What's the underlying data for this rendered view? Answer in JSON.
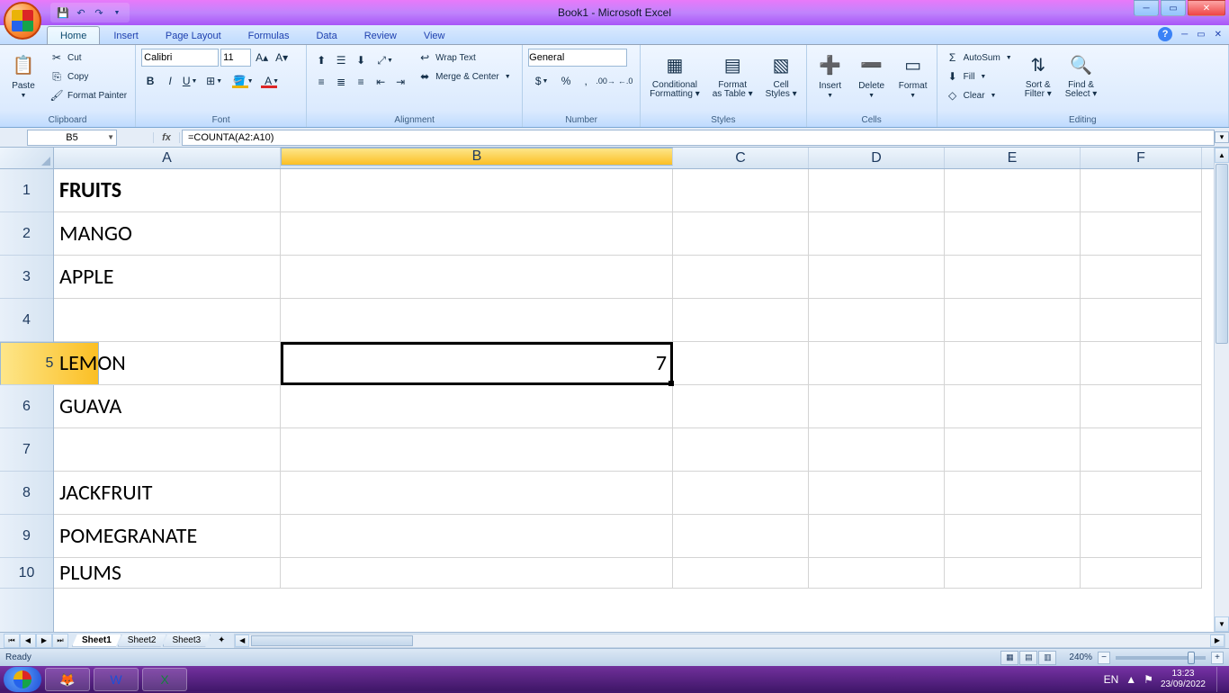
{
  "title": "Book1 - Microsoft Excel",
  "tabs": {
    "home": "Home",
    "insert": "Insert",
    "pagelayout": "Page Layout",
    "formulas": "Formulas",
    "data": "Data",
    "review": "Review",
    "view": "View"
  },
  "clipboard": {
    "label": "Clipboard",
    "paste": "Paste",
    "cut": "Cut",
    "copy": "Copy",
    "fp": "Format Painter"
  },
  "font": {
    "label": "Font",
    "name": "Calibri",
    "size": "11"
  },
  "alignment": {
    "label": "Alignment",
    "wrap": "Wrap Text",
    "merge": "Merge & Center"
  },
  "number": {
    "label": "Number",
    "format": "General"
  },
  "styles": {
    "label": "Styles",
    "cf": "Conditional Formatting",
    "fat": "Format as Table",
    "cs": "Cell Styles"
  },
  "cells": {
    "label": "Cells",
    "insert": "Insert",
    "delete": "Delete",
    "format": "Format"
  },
  "editing": {
    "label": "Editing",
    "autosum": "AutoSum",
    "fill": "Fill",
    "clear": "Clear",
    "sort": "Sort & Filter",
    "find": "Find & Select"
  },
  "namebox": "B5",
  "formula": "=COUNTA(A2:A10)",
  "cols": [
    "A",
    "B",
    "C",
    "D",
    "E",
    "F"
  ],
  "rows": [
    "1",
    "2",
    "3",
    "4",
    "5",
    "6",
    "7",
    "8",
    "9",
    "10"
  ],
  "cellA1": "FRUITS",
  "cellA2": "MANGO",
  "cellA3": "APPLE",
  "cellA5": "LEMON",
  "cellA6": "GUAVA",
  "cellA8": "JACKFRUIT",
  "cellA9": "POMEGRANATE",
  "cellA10": "PLUMS",
  "cellB5": "7",
  "sheets": {
    "s1": "Sheet1",
    "s2": "Sheet2",
    "s3": "Sheet3"
  },
  "status": "Ready",
  "zoom": "240%",
  "lang": "EN",
  "time": "13:23",
  "date": "23/09/2022"
}
